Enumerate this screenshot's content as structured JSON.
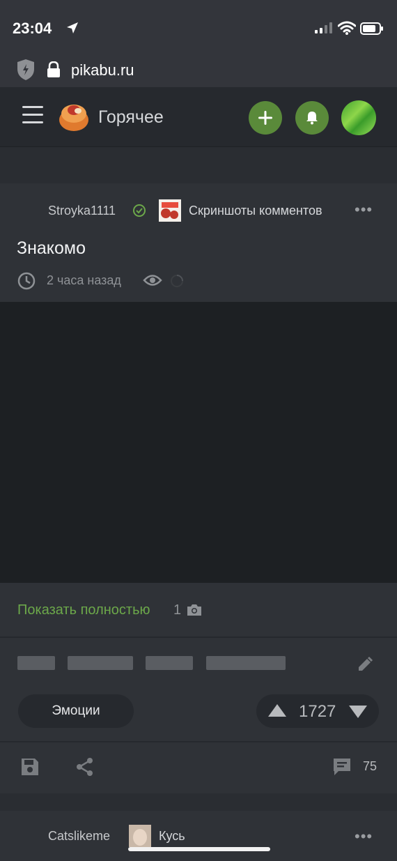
{
  "status_bar": {
    "time": "23:04"
  },
  "browser": {
    "url": "pikabu.ru"
  },
  "header": {
    "title": "Горячее"
  },
  "post": {
    "author": "Stroyka1111",
    "community": "Скриншоты комментов",
    "title": "Знакомо",
    "time_ago": "2 часа назад",
    "show_full_label": "Показать полностью",
    "photo_count": "1",
    "emotions_label": "Эмоции",
    "rating": "1727",
    "comments_count": "75"
  },
  "next_post": {
    "author": "Catslikeme",
    "community": "Кусь"
  },
  "colors": {
    "accent_green": "#6ca84a",
    "button_green": "#5a8a3a",
    "background": "#2a2d32"
  }
}
